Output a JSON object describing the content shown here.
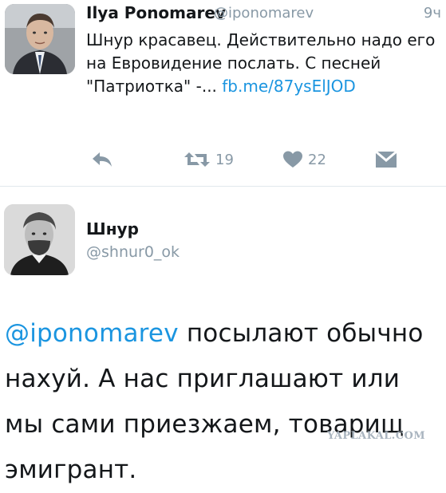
{
  "tweet_1": {
    "author_name": "Ilya Ponomarev",
    "handle": "@iponomarev",
    "time": "9ч",
    "text": "Шнур красавец. Действительно надо его на Евровидение послать. С песней \"Патриотка\" -...",
    "link": "fb.me/87ysElJOD",
    "retweet_count": "19",
    "like_count": "22"
  },
  "tweet_2": {
    "author_name": "Шнур",
    "handle": "@shnur0_ok",
    "mention": "@iponomarev",
    "text": "посылают обычно нахуй. А нас приглашают или мы сами приезжаем, товарищ эмигрант."
  },
  "watermark": "YAPLAKAL.COM",
  "colors": {
    "link": "#1b95e0",
    "muted": "#8899a6",
    "text": "#14171a",
    "divider": "#e1e8ed"
  },
  "icons": [
    "reply-icon",
    "retweet-icon",
    "like-icon",
    "direct-message-icon"
  ]
}
